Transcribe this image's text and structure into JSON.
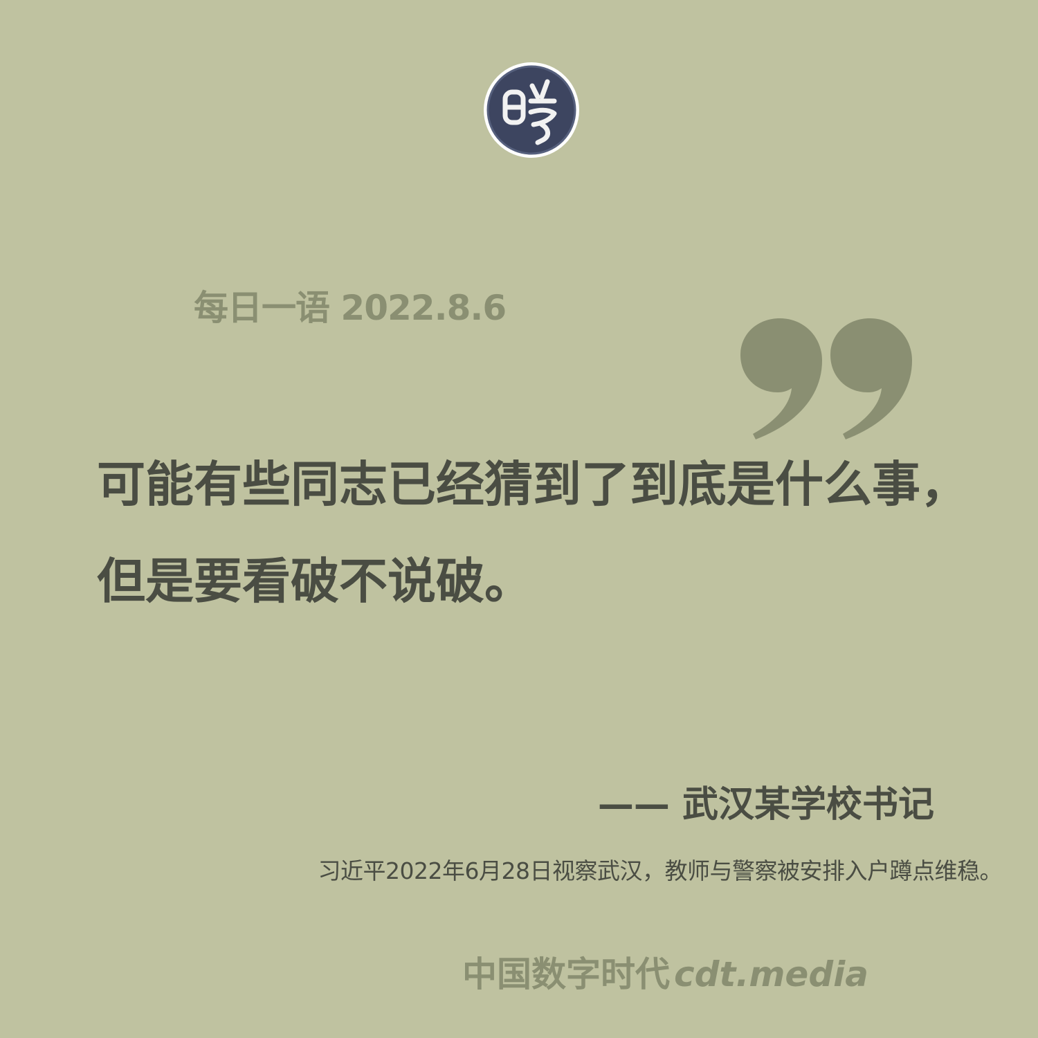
{
  "logo": {
    "icon": "seal-logo-icon",
    "glyph": "晓",
    "color": "#3d4560"
  },
  "header": {
    "title": "每日一语",
    "date": "2022.8.6"
  },
  "quote": {
    "icon": "close-quote-icon",
    "mark_color": "#8a8f72",
    "line1": "可能有些同志已经猜到了到底是什么事，",
    "line2": "但是要看破不说破。"
  },
  "attribution": {
    "text": "—— 武汉某学校书记"
  },
  "context": {
    "text": "习近平2022年6月28日视察武汉，教师与警察被安排入户蹲点维稳。"
  },
  "footer": {
    "brand_cn": "中国数字时代",
    "brand_en": "cdt.media"
  },
  "colors": {
    "background": "#bfc2a0",
    "text_dark": "#4a4d43",
    "text_muted": "#8a8f72"
  }
}
